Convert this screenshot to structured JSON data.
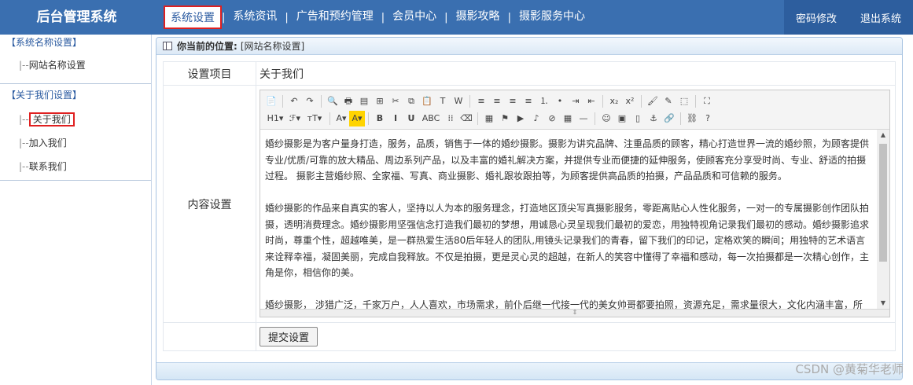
{
  "app": {
    "title": "后台管理系统"
  },
  "topnav": [
    {
      "label": "系统设置",
      "active": true
    },
    {
      "label": "系统资讯"
    },
    {
      "label": "广告和预约管理"
    },
    {
      "label": "会员中心"
    },
    {
      "label": "摄影攻略"
    },
    {
      "label": "摄影服务中心"
    }
  ],
  "topnav_separator": "|",
  "topright": {
    "change_password": "密码修改",
    "logout": "退出系统"
  },
  "sidebar": {
    "groups": [
      {
        "title": "【系统名称设置】",
        "items": [
          {
            "prefix": "|--",
            "label": "网站名称设置"
          }
        ]
      },
      {
        "title": "【关于我们设置】",
        "items": [
          {
            "prefix": "|--",
            "label": "关于我们",
            "active": true
          },
          {
            "prefix": "|--",
            "label": "加入我们"
          },
          {
            "prefix": "|--",
            "label": "联系我们"
          }
        ]
      }
    ]
  },
  "breadcrumb": {
    "label": "你当前的位置:",
    "value": "[网站名称设置]"
  },
  "form": {
    "row1_label": "设置项目",
    "row1_value": "关于我们",
    "row2_label": "内容设置",
    "submit": "提交设置"
  },
  "toolbar": {
    "row1": [
      "源码",
      "撤销",
      "重做",
      "预览",
      "打印",
      "模板",
      "代码",
      "剪切",
      "复制",
      "粘贴",
      "纯文本粘贴",
      "Word粘贴",
      "左对齐",
      "居中",
      "右对齐",
      "两端对齐",
      "编号",
      "项目符号",
      "缩进",
      "减少缩进",
      "下标",
      "上标",
      "格式刷",
      "清除格式",
      "全选",
      "全屏"
    ],
    "row2": [
      "H1",
      "F",
      "TT",
      "A",
      "A",
      "B",
      "I",
      "U",
      "ABC",
      "线",
      "橡皮",
      "图片",
      "Flash",
      "视频",
      "音频",
      "附件",
      "表格",
      "分隔线",
      "表情",
      "图片库",
      "分页",
      "锚点",
      "链接",
      "取消链接",
      "帮助"
    ]
  },
  "editor": {
    "paragraphs": [
      "婚纱摄影是为客户量身打造，服务，品质，销售于一体的婚纱摄影。摄影为讲究品牌、注重品质的顾客，精心打造世界一流的婚纱照，为顾客提供专业/优质/可靠的放大精品、周边系列产品，以及丰富的婚礼解决方案，并提供专业而便捷的延伸服务，使顾客充分享受时尚、专业、舒适的拍摄过程。 摄影主营婚纱照、全家福、写真、商业摄影、婚礼跟妆跟拍等，为顾客提供高品质的拍摄，产品品质和可信赖的服务。",
      "婚纱摄影的作品来自真实的客人，坚持以人为本的服务理念，打造地区顶尖写真摄影服务，零距离贴心人性化服务，一对一的专属摄影创作团队拍摄，透明消费理念。婚纱摄影用坚强信念打造我们最初的梦想，用诚恳心灵呈现我们最初的爱恋，用独特视角记录我们最初的感动。婚纱摄影追求时尚，尊重个性，超越唯美，是一群热爱生活80后年轻人的团队,用镜头记录我们的青春，留下我们的印记，定格欢笑的瞬间；用独特的艺术语言来诠释幸福，凝固美丽，完成自我释放。不仅是拍摄，更是灵心灵的超越，在新人的笑容中懂得了幸福和感动，每一次拍摄都是一次精心创作，主角是你，相信你的美。",
      "婚纱摄影， 涉猎广泛，千家万户，人人喜欢，市场需求，前仆后继一代接一代的美女帅哥都要拍照，资源充足，需求量很大，文化内涵丰富，所有新人都能从中感悟到它的视觉价值，并可以获得所属自己独特的唯一艺术作品，同时也记录了美女帅哥的自我青春魅力。"
    ]
  },
  "watermark": "CSDN @黄菊华老师"
}
